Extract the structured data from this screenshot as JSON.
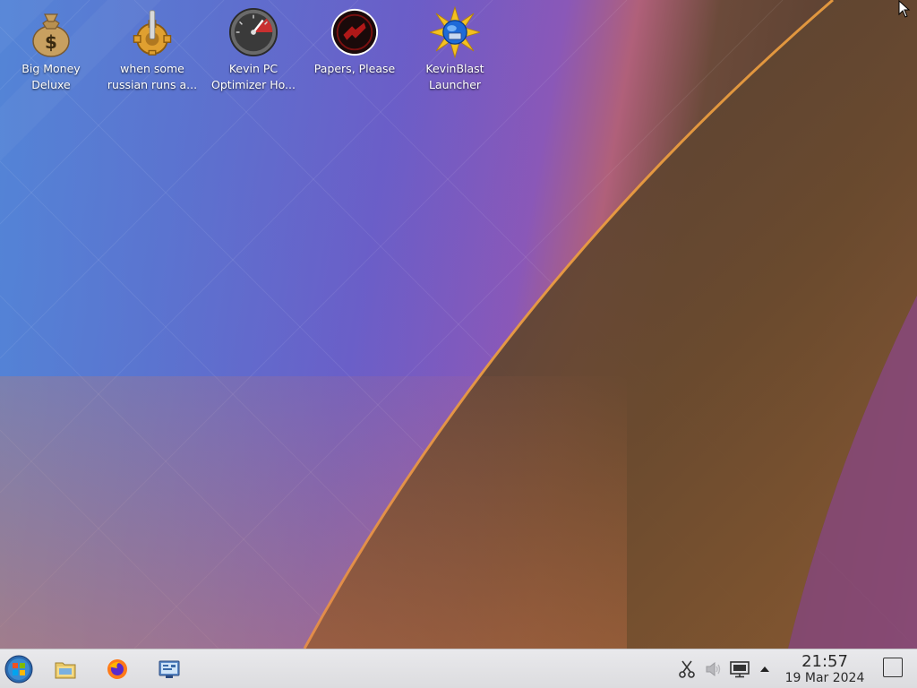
{
  "desktop": {
    "icons": [
      {
        "label": "Big Money\nDeluxe",
        "icon": "money-bag-icon"
      },
      {
        "label": "when some\nrussian runs a...",
        "icon": "gear-lever-icon"
      },
      {
        "label": "Kevin PC\nOptimizer Ho...",
        "icon": "speedometer-icon"
      },
      {
        "label": "Papers, Please",
        "icon": "passport-seal-icon"
      },
      {
        "label": "KevinBlast\nLauncher",
        "icon": "starburst-globe-icon"
      }
    ]
  },
  "taskbar": {
    "pinned": [
      {
        "icon": "start-orb-icon"
      },
      {
        "icon": "file-manager-icon"
      },
      {
        "icon": "firefox-icon"
      },
      {
        "icon": "system-settings-icon"
      }
    ],
    "tray": [
      {
        "icon": "scissors-icon"
      },
      {
        "icon": "volume-icon"
      },
      {
        "icon": "display-icon"
      },
      {
        "icon": "tray-expand-arrow-icon"
      }
    ],
    "clock": {
      "time": "21:57",
      "date": "19 Mar 2024"
    },
    "show_desktop_icon": "show-desktop-icon"
  }
}
